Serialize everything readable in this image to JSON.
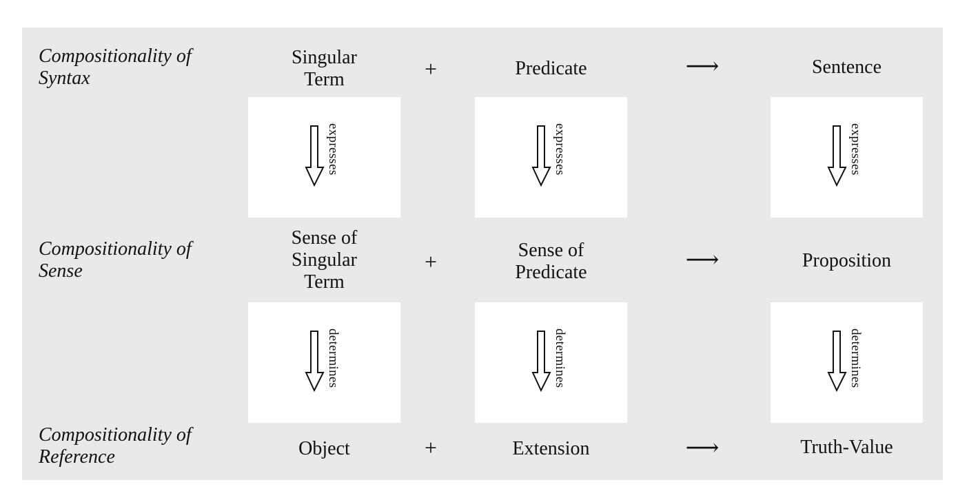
{
  "rows": [
    {
      "label": [
        "Compositionality of",
        "Syntax"
      ],
      "first": [
        "Singular",
        "Term"
      ],
      "operator": "+",
      "second": [
        "Predicate"
      ],
      "result_arrow": "⟶",
      "result": [
        "Sentence"
      ]
    },
    {
      "label": [
        "Compositionality of",
        "Sense"
      ],
      "first": [
        "Sense of",
        "Singular",
        "Term"
      ],
      "operator": "+",
      "second": [
        "Sense of",
        "Predicate"
      ],
      "result_arrow": "⟶",
      "result": [
        "Proposition"
      ]
    },
    {
      "label": [
        "Compositionality of",
        "Reference"
      ],
      "first": [
        "Object"
      ],
      "operator": "+",
      "second": [
        "Extension"
      ],
      "result_arrow": "⟶",
      "result": [
        "Truth-Value"
      ]
    }
  ],
  "connectors": [
    {
      "relation": "expresses",
      "icon": "hollow-down-arrow-icon"
    },
    {
      "relation": "determines",
      "icon": "hollow-down-arrow-icon"
    }
  ],
  "colors": {
    "panel": "#e9e9e9",
    "box": "#ffffff",
    "text": "#111111"
  }
}
